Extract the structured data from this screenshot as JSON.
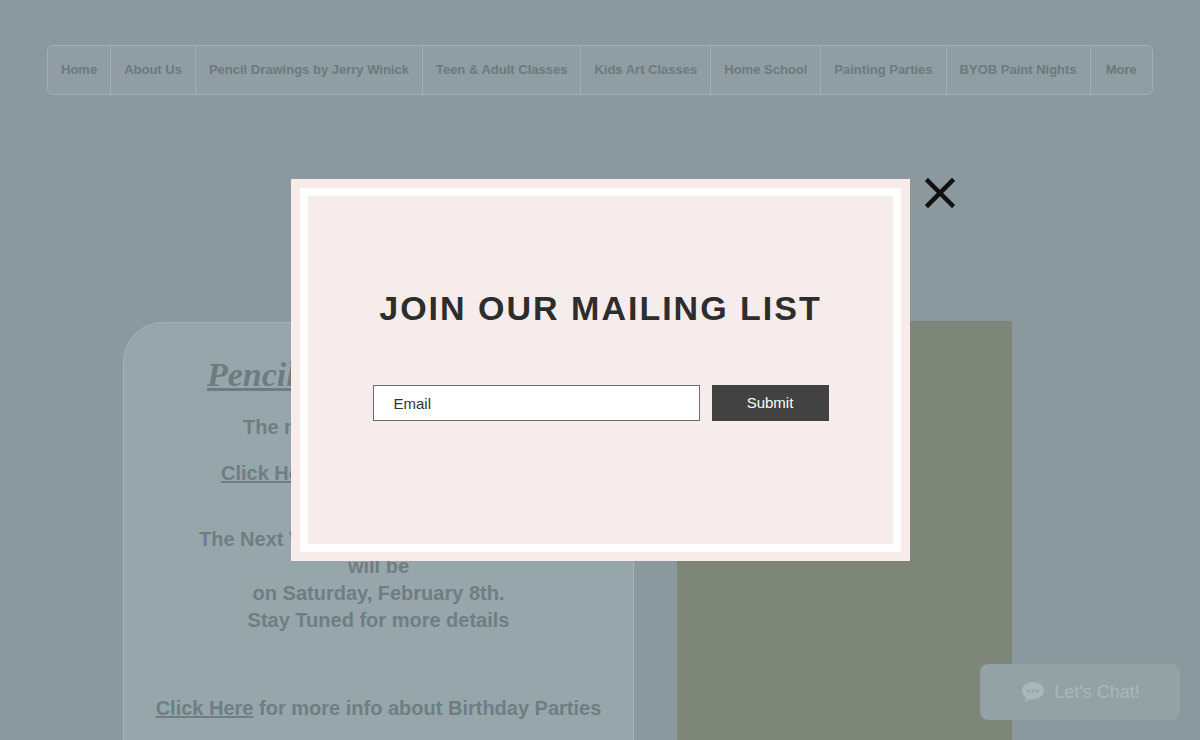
{
  "nav": {
    "items": [
      {
        "label": "Home"
      },
      {
        "label": "About Us"
      },
      {
        "label": "Pencil Drawings by Jerry Winick"
      },
      {
        "label": "Teen & Adult Classes"
      },
      {
        "label": "Kids Art Classes"
      },
      {
        "label": "Home School"
      },
      {
        "label": "Painting Parties"
      },
      {
        "label": "BYOB Paint Nights"
      },
      {
        "label": "More"
      }
    ]
  },
  "card": {
    "lines": [
      {
        "kind": "heading",
        "text": "Pencil"
      },
      {
        "kind": "text",
        "text": "The n"
      },
      {
        "kind": "link",
        "text": "Click He"
      },
      {
        "kind": "text",
        "text": "The Next V"
      },
      {
        "kind": "text",
        "text": "will be"
      },
      {
        "kind": "text",
        "text": "on Saturday, February 8th."
      },
      {
        "kind": "text",
        "text": "Stay Tuned for more details"
      }
    ],
    "footer": {
      "link": "Click Here",
      "text": " for more info about Birthday Parties"
    }
  },
  "modal": {
    "title": "JOIN OUR MAILING LIST",
    "email_placeholder": "Email",
    "submit": "Submit"
  },
  "chat": {
    "label": "Let's Chat!"
  }
}
